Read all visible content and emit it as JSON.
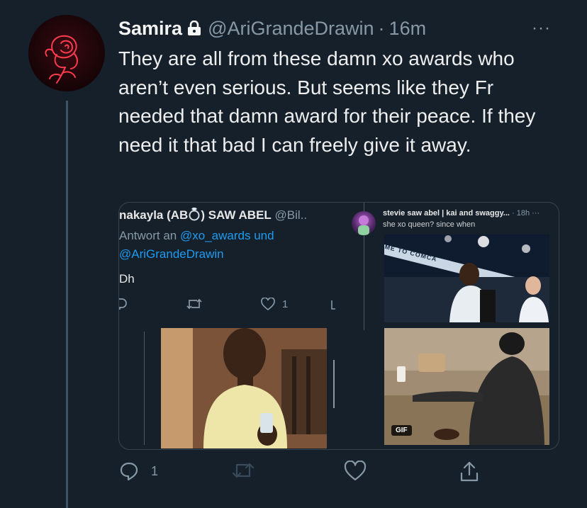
{
  "tweet": {
    "author_name": "Samira",
    "author_handle": "@AriGrandeDrawin",
    "time_separator": "·",
    "time": "16m",
    "more_label": "···",
    "text": "They are all from these damn xo awards who aren’t even serious. But seems like they Fr needed that damn award for their peace. If they need it that bad I can freely give it away.",
    "reply_count": "1"
  },
  "quoted_left": {
    "name_prefix": "nakayla (AB",
    "name_suffix": ") SAW ABEL",
    "handle": "@Bil..",
    "reply_prefix": "Antwort an",
    "reply_link_1": "@xo_awards",
    "reply_conj": "und",
    "reply_link_2": "@AriGrandeDrawin",
    "text": "Dh",
    "like_count": "1"
  },
  "quoted_right": {
    "name": "stevie saw abel | kai and swaggy...",
    "time": "· 18h",
    "more": "···",
    "text": "she xo queen? since when",
    "gif_label": "GIF",
    "banner_text": "ME TO COMCA"
  },
  "colors": {
    "background": "#15202b",
    "secondary_text": "#8899a6",
    "link": "#1d9bf0",
    "border": "#38444d"
  }
}
